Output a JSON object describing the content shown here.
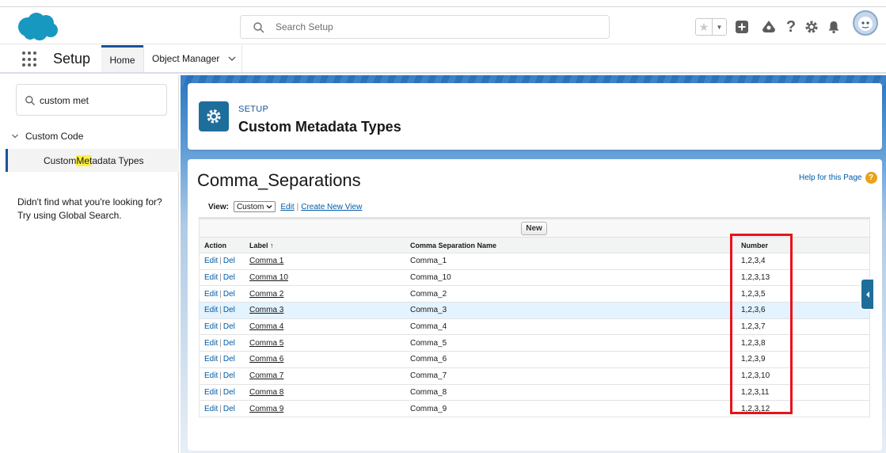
{
  "header": {
    "search_placeholder": "Search Setup",
    "icons": [
      "star-icon",
      "caret-down-icon",
      "add-icon",
      "trailhead-icon",
      "help-icon",
      "gear-icon",
      "bell-icon",
      "avatar"
    ]
  },
  "nav": {
    "app_name": "Setup",
    "tabs": [
      {
        "label": "Home",
        "active": true
      },
      {
        "label": "Object Manager",
        "active": false
      }
    ]
  },
  "sidebar": {
    "quick_find_value": "custom met",
    "tree": {
      "parent_label": "Custom Code",
      "child_label_pre": "Custom ",
      "child_label_hl": "Met",
      "child_label_post": "adata Types"
    },
    "not_found_line1": "Didn't find what you're looking for?",
    "not_found_line2": "Try using Global Search."
  },
  "page_header": {
    "eyebrow": "SETUP",
    "title": "Custom Metadata Types"
  },
  "list": {
    "title": "Comma_Separations",
    "help_link": "Help for this Page",
    "view_label": "View:",
    "view_value": "Custom",
    "edit_link": "Edit",
    "create_view_link": "Create New View",
    "new_button": "New",
    "columns": {
      "action": "Action",
      "label": "Label",
      "sort_indicator": "↑",
      "name": "Comma Separation Name",
      "number": "Number"
    },
    "action_edit": "Edit",
    "action_sep": "|",
    "action_del": "Del",
    "rows": [
      {
        "label": "Comma 1",
        "name": "Comma_1",
        "number": "1,2,3,4"
      },
      {
        "label": "Comma 10",
        "name": "Comma_10",
        "number": "1,2,3,13"
      },
      {
        "label": "Comma 2",
        "name": "Comma_2",
        "number": "1,2,3,5"
      },
      {
        "label": "Comma 3",
        "name": "Comma_3",
        "number": "1,2,3,6"
      },
      {
        "label": "Comma 4",
        "name": "Comma_4",
        "number": "1,2,3,7"
      },
      {
        "label": "Comma 5",
        "name": "Comma_5",
        "number": "1,2,3,8"
      },
      {
        "label": "Comma 6",
        "name": "Comma_6",
        "number": "1,2,3,9"
      },
      {
        "label": "Comma 7",
        "name": "Comma_7",
        "number": "1,2,3,10"
      },
      {
        "label": "Comma 8",
        "name": "Comma_8",
        "number": "1,2,3,11"
      },
      {
        "label": "Comma 9",
        "name": "Comma_9",
        "number": "1,2,3,12"
      }
    ],
    "highlighted_row_index": 3
  },
  "colors": {
    "brand_blue": "#1b5297",
    "setup_icon_bg": "#1e6e9b",
    "link_blue": "#015ba7",
    "annotation_red": "#e8131b",
    "search_highlight": "#fff03f"
  }
}
